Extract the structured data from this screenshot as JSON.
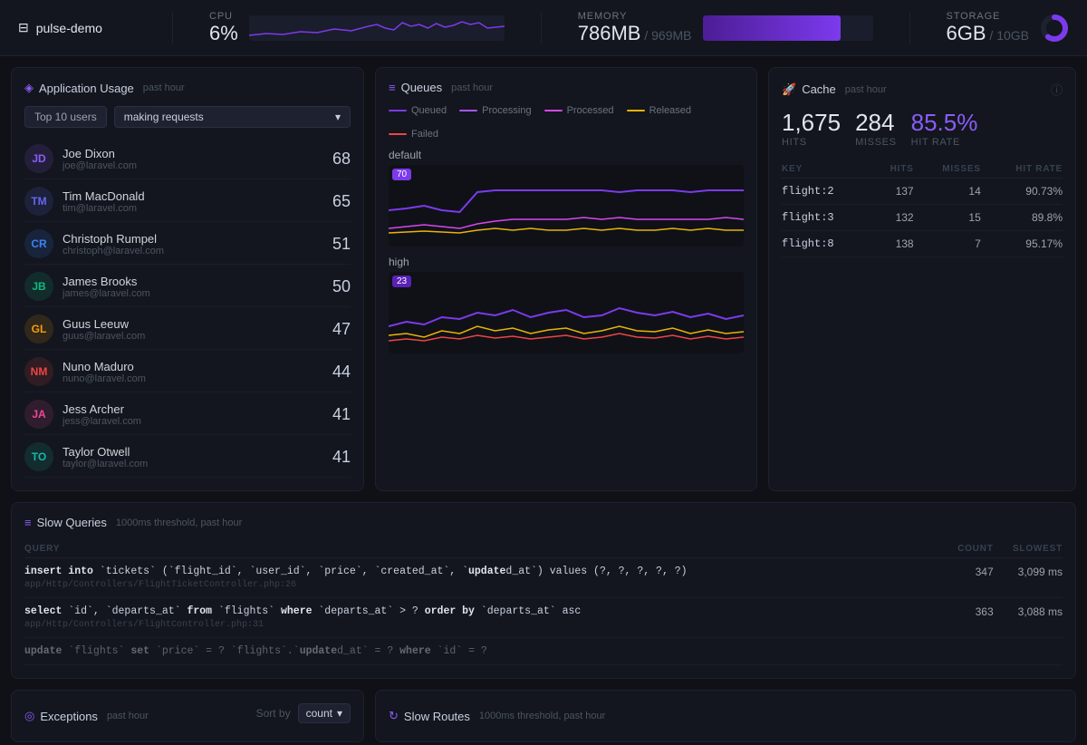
{
  "topbar": {
    "brand": "pulse-demo",
    "brand_icon": "⊟",
    "cpu_label": "CPU",
    "cpu_value": "6%",
    "memory_label": "MEMORY",
    "memory_value": "786MB",
    "memory_total": "969MB",
    "memory_sep": "/",
    "storage_label": "STORAGE",
    "storage_value": "6GB",
    "storage_total": "10GB",
    "storage_sep": "/"
  },
  "app_usage": {
    "title": "Application Usage",
    "subtitle": "past hour",
    "filter_top": "Top 10 users",
    "filter_type": "making requests",
    "users": [
      {
        "name": "Joe Dixon",
        "email": "joe@laravel.com",
        "count": 68,
        "initials": "JD"
      },
      {
        "name": "Tim MacDonald",
        "email": "tim@laravel.com",
        "count": 65,
        "initials": "TM"
      },
      {
        "name": "Christoph Rumpel",
        "email": "christoph@laravel.com",
        "count": 51,
        "initials": "CR"
      },
      {
        "name": "James Brooks",
        "email": "james@laravel.com",
        "count": 50,
        "initials": "JB"
      },
      {
        "name": "Guus Leeuw",
        "email": "guus@laravel.com",
        "count": 47,
        "initials": "GL"
      },
      {
        "name": "Nuno Maduro",
        "email": "nuno@laravel.com",
        "count": 44,
        "initials": "NM"
      },
      {
        "name": "Jess Archer",
        "email": "jess@laravel.com",
        "count": 41,
        "initials": "JA"
      },
      {
        "name": "Taylor Otwell",
        "email": "taylor@laravel.com",
        "count": 41,
        "initials": "TO"
      }
    ]
  },
  "queues": {
    "title": "Queues",
    "subtitle": "past hour",
    "legend": [
      {
        "label": "Queued",
        "color": "#7c3aed"
      },
      {
        "label": "Processing",
        "color": "#a855f7"
      },
      {
        "label": "Processed",
        "color": "#d946ef"
      },
      {
        "label": "Released",
        "color": "#eab308"
      },
      {
        "label": "Failed",
        "color": "#ef4444"
      }
    ],
    "sections": [
      {
        "name": "default",
        "badge": 70
      },
      {
        "name": "high",
        "badge": 23
      }
    ]
  },
  "cache": {
    "title": "Cache",
    "subtitle": "past hour",
    "hits_value": "1,675",
    "hits_label": "HITS",
    "misses_value": "284",
    "misses_label": "MISSES",
    "rate_value": "85.5%",
    "rate_label": "HIT RATE",
    "table_headers": [
      "KEY",
      "HITS",
      "MISSES",
      "HIT RATE"
    ],
    "rows": [
      {
        "key": "flight:2",
        "hits": 137,
        "misses": 14,
        "rate": "90.73%"
      },
      {
        "key": "flight:3",
        "hits": 132,
        "misses": 15,
        "rate": "89.8%"
      },
      {
        "key": "flight:8",
        "hits": 138,
        "misses": 7,
        "rate": "95.17%"
      }
    ]
  },
  "slow_queries": {
    "title": "Slow Queries",
    "subtitle": "1000ms threshold, past hour",
    "col_query": "QUERY",
    "col_count": "COUNT",
    "col_slowest": "SLOWEST",
    "rows": [
      {
        "query": "insert into `tickets` (`flight_id`, `user_id`, `price`, `created_at`, `updated_at`) values (?, ?, ?, ?, ?)",
        "file": "app/Http/Controllers/FlightTicketController.php:26",
        "count": 347,
        "slowest": "3,099 ms"
      },
      {
        "query": "select `id`, `departs_at` from `flights` where `departs_at` > ? order by `departs_at` asc",
        "file": "app/Http/Controllers/FlightController.php:31",
        "count": 363,
        "slowest": "3,088 ms"
      },
      {
        "query": "update `flights` set `price` = ? `flights`.`updated_at` = ? where `id` = ?",
        "file": "",
        "count": null,
        "slowest": null,
        "faded": true
      }
    ]
  },
  "exceptions": {
    "title": "Exceptions",
    "subtitle": "past hour",
    "sort_label": "Sort by",
    "sort_value": "count",
    "sort_icon": "▾"
  },
  "slow_routes": {
    "title": "Slow Routes",
    "subtitle": "1000ms threshold, past hour"
  },
  "icons": {
    "server": "⊟",
    "activity": "◈",
    "queue": "≡",
    "cache": "🚀",
    "query": "≡",
    "exception": "◎",
    "route": "↻",
    "chevron_down": "▾",
    "info": "ⓘ"
  }
}
